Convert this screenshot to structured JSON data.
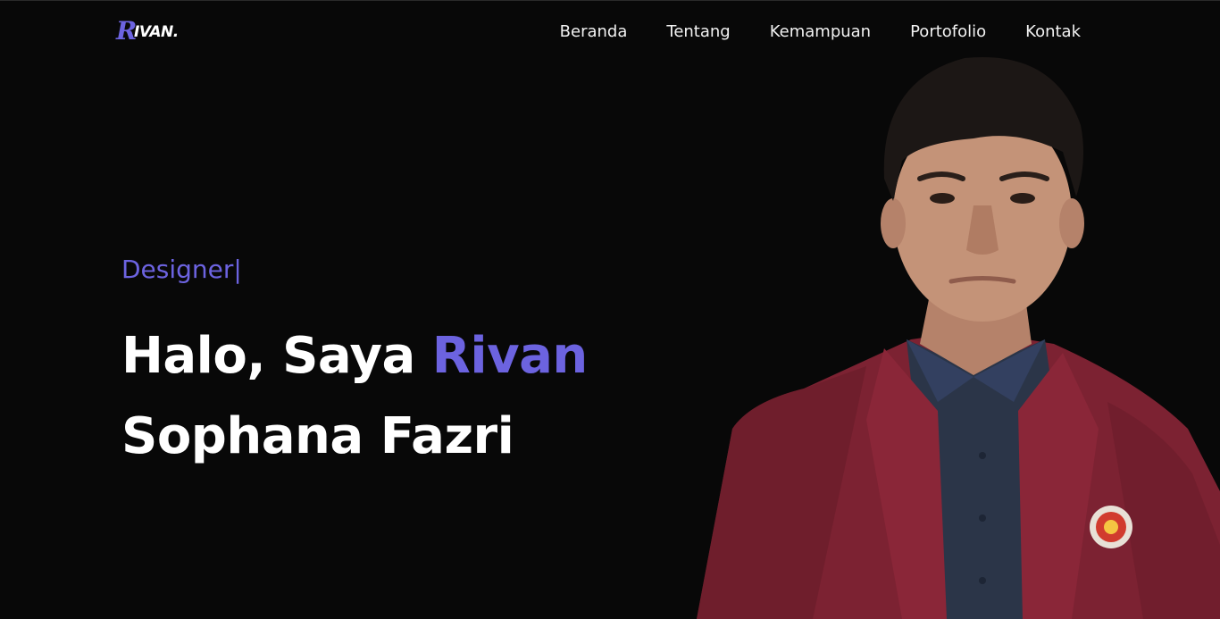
{
  "header": {
    "logo_first": "R",
    "logo_rest": "IVAN.",
    "nav": [
      "Beranda",
      "Tentang",
      "Kemampuan",
      "Portofolio",
      "Kontak"
    ]
  },
  "hero": {
    "role": "Designer",
    "cursor": "|",
    "greeting": "Halo, Saya ",
    "first_name": "Rivan",
    "last_name": "Sophana Fazri"
  },
  "colors": {
    "background": "#080808",
    "accent": "#6c63e0",
    "text": "#ffffff",
    "jacket": "#7c2232",
    "shirt": "#2b3548",
    "skin": "#c49378",
    "hair": "#1c1715"
  },
  "icons": {
    "emblem": "university-emblem-icon"
  }
}
